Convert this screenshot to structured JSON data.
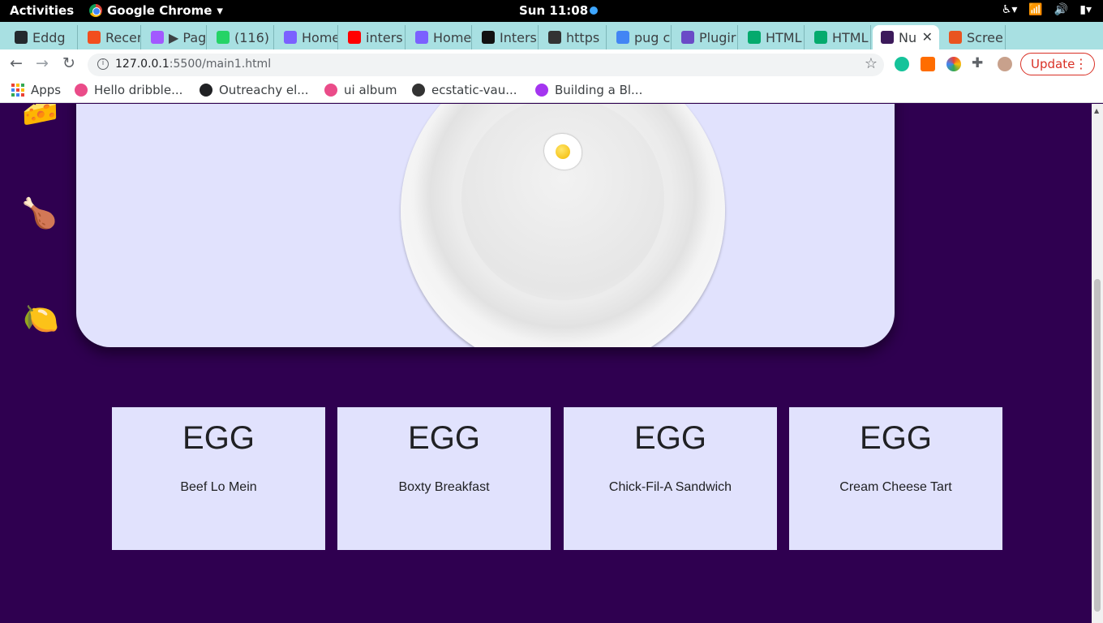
{
  "system_bar": {
    "activities": "Activities",
    "app_name": "Google Chrome",
    "clock": "Sun 11:08"
  },
  "tabs": [
    {
      "label": "Eddg",
      "icon": "github-icon",
      "color": "#24292e"
    },
    {
      "label": "Recer",
      "icon": "figma-icon",
      "color": "#f24e1e"
    },
    {
      "label": "▶ Pag",
      "icon": "figma-icon",
      "color": "#a259ff"
    },
    {
      "label": "(116)",
      "icon": "badge-icon",
      "color": "#25d366"
    },
    {
      "label": "Home",
      "icon": "arrow-icon",
      "color": "#7b61ff"
    },
    {
      "label": "inters",
      "icon": "youtube-icon",
      "color": "#ff0000"
    },
    {
      "label": "Home",
      "icon": "arrow-icon",
      "color": "#7b61ff"
    },
    {
      "label": "Inters",
      "icon": "internshala-icon",
      "color": "#111111"
    },
    {
      "label": "https",
      "icon": "hw-icon",
      "color": "#333333"
    },
    {
      "label": "pug c",
      "icon": "google-icon",
      "color": "#4285f4"
    },
    {
      "label": "Plugir",
      "icon": "plugin-icon",
      "color": "#6a4bc7"
    },
    {
      "label": "HTML",
      "icon": "w3-icon",
      "color": "#04aa6d"
    },
    {
      "label": "HTML",
      "icon": "w3-icon",
      "color": "#04aa6d"
    },
    {
      "label": "Nu",
      "icon": "nu-icon",
      "color": "#3c1a5b",
      "active": true
    },
    {
      "label": "Scree",
      "icon": "ubuntu-icon",
      "color": "#e95420"
    }
  ],
  "toolbar": {
    "url_host": "127.0.0.1",
    "url_rest": ":5500/main1.html",
    "update_label": "Update"
  },
  "bookmarks": [
    {
      "label": "Apps",
      "icon": "apps-grid-icon"
    },
    {
      "label": "Hello dribble...",
      "icon": "dribbble-icon",
      "color": "#ea4c89"
    },
    {
      "label": "Outreachy el...",
      "icon": "globe-icon",
      "color": "#202124"
    },
    {
      "label": "ui album",
      "icon": "dribbble-icon",
      "color": "#ea4c89"
    },
    {
      "label": "ecstatic-vau...",
      "icon": "codesandbox-icon",
      "color": "#333333"
    },
    {
      "label": "Building a Bl...",
      "icon": "udemy-icon",
      "color": "#a435f0"
    }
  ],
  "side_icons": [
    {
      "name": "cheese-icon",
      "glyph": "🧀"
    },
    {
      "name": "chicken-leg-icon",
      "glyph": "🍗"
    },
    {
      "name": "lemon-icon",
      "glyph": "🍋"
    }
  ],
  "cards": [
    {
      "title": "EGG",
      "name": "Beef Lo Mein"
    },
    {
      "title": "EGG",
      "name": "Boxty Breakfast"
    },
    {
      "title": "EGG",
      "name": "Chick-Fil-A Sandwich"
    },
    {
      "title": "EGG",
      "name": "Cream Cheese Tart"
    }
  ],
  "colors": {
    "page_background": "#2f0050",
    "card_background": "#e1e2fd",
    "tab_strip": "#a8e0e2"
  }
}
